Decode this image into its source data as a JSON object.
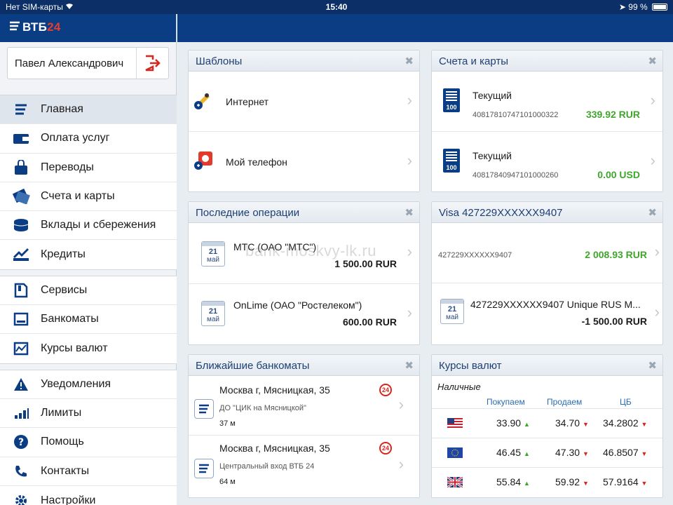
{
  "status_bar": {
    "carrier": "Нет SIM-карты",
    "time": "15:40",
    "battery": "99 %"
  },
  "brand": {
    "logo_text": "ВТБ",
    "logo_num": "24"
  },
  "user": {
    "name": "Павел Александрович"
  },
  "menu": {
    "group1": [
      {
        "label": "Главная",
        "icon": "home-icon"
      },
      {
        "label": "Оплата услуг",
        "icon": "wallet-icon"
      },
      {
        "label": "Переводы",
        "icon": "transfer-icon"
      },
      {
        "label": "Счета и карты",
        "icon": "cards-icon"
      },
      {
        "label": "Вклады и сбережения",
        "icon": "coins-icon"
      },
      {
        "label": "Кредиты",
        "icon": "credit-icon"
      }
    ],
    "group2": [
      {
        "label": "Сервисы",
        "icon": "services-icon"
      },
      {
        "label": "Банкоматы",
        "icon": "atm-icon"
      },
      {
        "label": "Курсы валют",
        "icon": "rates-chart-icon"
      }
    ],
    "group3": [
      {
        "label": "Уведомления",
        "icon": "warning-icon"
      },
      {
        "label": "Лимиты",
        "icon": "bars-icon"
      },
      {
        "label": "Помощь",
        "icon": "help-icon"
      },
      {
        "label": "Контакты",
        "icon": "phone-icon"
      },
      {
        "label": "Настройки",
        "icon": "gear-icon"
      }
    ]
  },
  "templates": {
    "title": "Шаблоны",
    "items": [
      {
        "label": "Интернет"
      },
      {
        "label": "Мой телефон"
      }
    ]
  },
  "accounts": {
    "title": "Счета и карты",
    "items": [
      {
        "name": "Текущий",
        "number": "40817810747101000322",
        "amount": "339.92 RUR",
        "icon_num": "100"
      },
      {
        "name": "Текущий",
        "number": "40817840947101000260",
        "amount": "0.00 USD",
        "icon_num": "100"
      }
    ]
  },
  "operations": {
    "title": "Последние операции",
    "items": [
      {
        "day": "21",
        "month": "май",
        "name": "МТС (ОАО \"МТС\")",
        "amount": "1 500.00 RUR"
      },
      {
        "day": "21",
        "month": "май",
        "name": "OnLime (ОАО \"Ростелеком\")",
        "amount": "600.00 RUR"
      }
    ]
  },
  "visa": {
    "title": "Visa 427229XXXXXX9407",
    "balance_number": "427229XXXXXX9407",
    "balance": "2 008.93 RUR",
    "op": {
      "day": "21",
      "month": "май",
      "name": "427229XXXXXX9407 Unique RUS M...",
      "amount": "-1 500.00 RUR"
    }
  },
  "atms": {
    "title": "Ближайшие банкоматы",
    "items": [
      {
        "address": "Москва г, Мясницкая, 35",
        "desc": "ДО \"ЦИК на Мясницкой\"",
        "distance": "37 м",
        "badge": "24"
      },
      {
        "address": "Москва г, Мясницкая, 35",
        "desc": "Центральный вход ВТБ 24",
        "distance": "64 м",
        "badge": "24"
      }
    ]
  },
  "rates": {
    "title": "Курсы валют",
    "cash_label": "Наличные",
    "headers": {
      "buy": "Покупаем",
      "sell": "Продаем",
      "cb": "ЦБ"
    },
    "rows": [
      {
        "flag": "usa-flag",
        "buy": "33.90",
        "buy_dir": "up",
        "sell": "34.70",
        "sell_dir": "down",
        "cb": "34.2802",
        "cb_dir": "down"
      },
      {
        "flag": "eu-flag",
        "buy": "46.45",
        "buy_dir": "up",
        "sell": "47.30",
        "sell_dir": "down",
        "cb": "46.8507",
        "cb_dir": "down"
      },
      {
        "flag": "uk-flag",
        "buy": "55.84",
        "buy_dir": "up",
        "sell": "59.92",
        "sell_dir": "down",
        "cb": "57.9164",
        "cb_dir": "down"
      }
    ]
  },
  "watermark": "bank-moskvy-lk.ru",
  "colors": {
    "brand_blue": "#0b3d85",
    "brand_red": "#e53e2e",
    "positive_green": "#3fa62c",
    "negative_red": "#d7261e"
  }
}
